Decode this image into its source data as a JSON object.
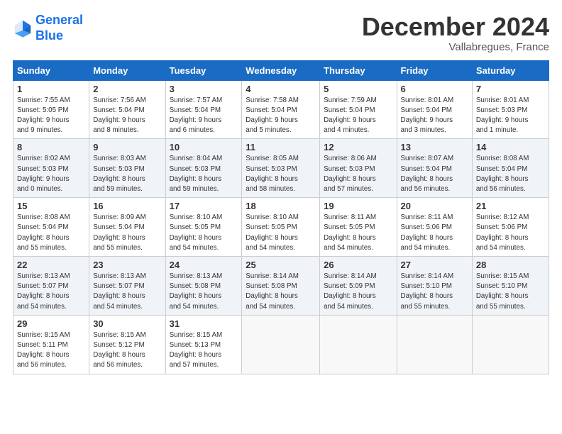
{
  "header": {
    "logo_line1": "General",
    "logo_line2": "Blue",
    "month_title": "December 2024",
    "subtitle": "Vallabregues, France"
  },
  "weekdays": [
    "Sunday",
    "Monday",
    "Tuesday",
    "Wednesday",
    "Thursday",
    "Friday",
    "Saturday"
  ],
  "weeks": [
    [
      {
        "day": "1",
        "info": "Sunrise: 7:55 AM\nSunset: 5:05 PM\nDaylight: 9 hours\nand 9 minutes."
      },
      {
        "day": "2",
        "info": "Sunrise: 7:56 AM\nSunset: 5:04 PM\nDaylight: 9 hours\nand 8 minutes."
      },
      {
        "day": "3",
        "info": "Sunrise: 7:57 AM\nSunset: 5:04 PM\nDaylight: 9 hours\nand 6 minutes."
      },
      {
        "day": "4",
        "info": "Sunrise: 7:58 AM\nSunset: 5:04 PM\nDaylight: 9 hours\nand 5 minutes."
      },
      {
        "day": "5",
        "info": "Sunrise: 7:59 AM\nSunset: 5:04 PM\nDaylight: 9 hours\nand 4 minutes."
      },
      {
        "day": "6",
        "info": "Sunrise: 8:01 AM\nSunset: 5:04 PM\nDaylight: 9 hours\nand 3 minutes."
      },
      {
        "day": "7",
        "info": "Sunrise: 8:01 AM\nSunset: 5:03 PM\nDaylight: 9 hours\nand 1 minute."
      }
    ],
    [
      {
        "day": "8",
        "info": "Sunrise: 8:02 AM\nSunset: 5:03 PM\nDaylight: 9 hours\nand 0 minutes."
      },
      {
        "day": "9",
        "info": "Sunrise: 8:03 AM\nSunset: 5:03 PM\nDaylight: 8 hours\nand 59 minutes."
      },
      {
        "day": "10",
        "info": "Sunrise: 8:04 AM\nSunset: 5:03 PM\nDaylight: 8 hours\nand 59 minutes."
      },
      {
        "day": "11",
        "info": "Sunrise: 8:05 AM\nSunset: 5:03 PM\nDaylight: 8 hours\nand 58 minutes."
      },
      {
        "day": "12",
        "info": "Sunrise: 8:06 AM\nSunset: 5:03 PM\nDaylight: 8 hours\nand 57 minutes."
      },
      {
        "day": "13",
        "info": "Sunrise: 8:07 AM\nSunset: 5:04 PM\nDaylight: 8 hours\nand 56 minutes."
      },
      {
        "day": "14",
        "info": "Sunrise: 8:08 AM\nSunset: 5:04 PM\nDaylight: 8 hours\nand 56 minutes."
      }
    ],
    [
      {
        "day": "15",
        "info": "Sunrise: 8:08 AM\nSunset: 5:04 PM\nDaylight: 8 hours\nand 55 minutes."
      },
      {
        "day": "16",
        "info": "Sunrise: 8:09 AM\nSunset: 5:04 PM\nDaylight: 8 hours\nand 55 minutes."
      },
      {
        "day": "17",
        "info": "Sunrise: 8:10 AM\nSunset: 5:05 PM\nDaylight: 8 hours\nand 54 minutes."
      },
      {
        "day": "18",
        "info": "Sunrise: 8:10 AM\nSunset: 5:05 PM\nDaylight: 8 hours\nand 54 minutes."
      },
      {
        "day": "19",
        "info": "Sunrise: 8:11 AM\nSunset: 5:05 PM\nDaylight: 8 hours\nand 54 minutes."
      },
      {
        "day": "20",
        "info": "Sunrise: 8:11 AM\nSunset: 5:06 PM\nDaylight: 8 hours\nand 54 minutes."
      },
      {
        "day": "21",
        "info": "Sunrise: 8:12 AM\nSunset: 5:06 PM\nDaylight: 8 hours\nand 54 minutes."
      }
    ],
    [
      {
        "day": "22",
        "info": "Sunrise: 8:13 AM\nSunset: 5:07 PM\nDaylight: 8 hours\nand 54 minutes."
      },
      {
        "day": "23",
        "info": "Sunrise: 8:13 AM\nSunset: 5:07 PM\nDaylight: 8 hours\nand 54 minutes."
      },
      {
        "day": "24",
        "info": "Sunrise: 8:13 AM\nSunset: 5:08 PM\nDaylight: 8 hours\nand 54 minutes."
      },
      {
        "day": "25",
        "info": "Sunrise: 8:14 AM\nSunset: 5:08 PM\nDaylight: 8 hours\nand 54 minutes."
      },
      {
        "day": "26",
        "info": "Sunrise: 8:14 AM\nSunset: 5:09 PM\nDaylight: 8 hours\nand 54 minutes."
      },
      {
        "day": "27",
        "info": "Sunrise: 8:14 AM\nSunset: 5:10 PM\nDaylight: 8 hours\nand 55 minutes."
      },
      {
        "day": "28",
        "info": "Sunrise: 8:15 AM\nSunset: 5:10 PM\nDaylight: 8 hours\nand 55 minutes."
      }
    ],
    [
      {
        "day": "29",
        "info": "Sunrise: 8:15 AM\nSunset: 5:11 PM\nDaylight: 8 hours\nand 56 minutes."
      },
      {
        "day": "30",
        "info": "Sunrise: 8:15 AM\nSunset: 5:12 PM\nDaylight: 8 hours\nand 56 minutes."
      },
      {
        "day": "31",
        "info": "Sunrise: 8:15 AM\nSunset: 5:13 PM\nDaylight: 8 hours\nand 57 minutes."
      },
      {
        "day": "",
        "info": ""
      },
      {
        "day": "",
        "info": ""
      },
      {
        "day": "",
        "info": ""
      },
      {
        "day": "",
        "info": ""
      }
    ]
  ]
}
